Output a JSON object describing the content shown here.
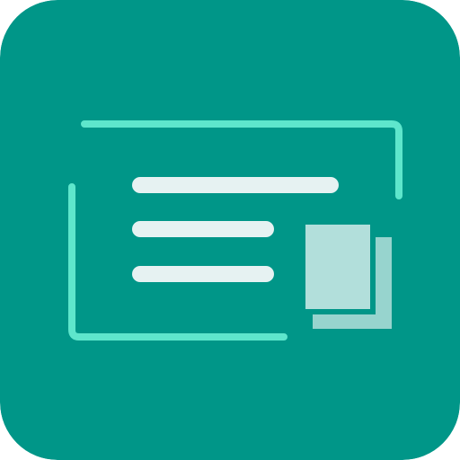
{
  "icon": {
    "name": "copy-text-app-icon",
    "glyphs": [
      "document-lines-icon",
      "copy-pages-icon",
      "bracket-frame"
    ],
    "colors": {
      "background": "#009688",
      "frame": "#5ee6cc",
      "lines": "#e6f2f2",
      "page_front": "#b2dfdb",
      "page_back": "#b2dfdb"
    }
  }
}
